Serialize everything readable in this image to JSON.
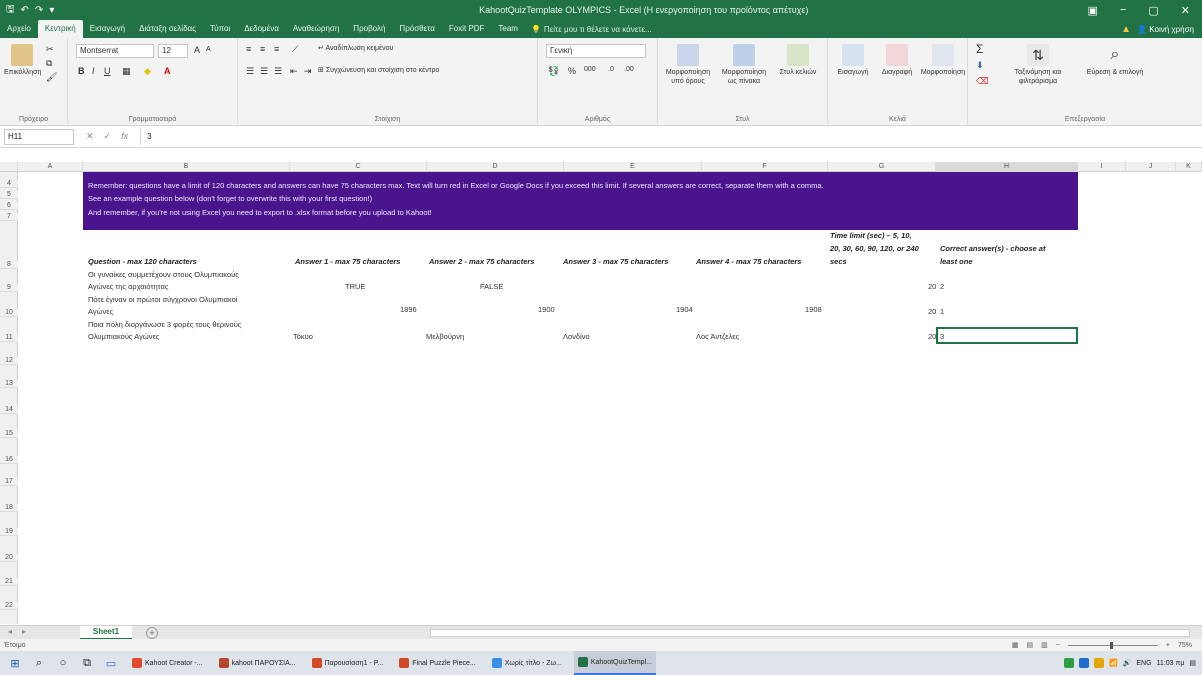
{
  "window": {
    "title": "KahootQuizTemplate OLYMPICS - Excel (Η ενεργοποίηση του προϊόντος απέτυχε)",
    "user": "Κοινή χρήση",
    "min": "−",
    "max": "▢",
    "close": "✕"
  },
  "tabs": [
    "Αρχείο",
    "Κεντρική",
    "Εισαγωγή",
    "Διάταξη σελίδας",
    "Τύποι",
    "Δεδομένα",
    "Αναθεώρηση",
    "Προβολή",
    "Πρόσθετα",
    "Foxit PDF",
    "Team"
  ],
  "tell_me": "Πείτε μου τι θέλετε να κάνετε...",
  "ribbon": {
    "paste": "Επικόλληση",
    "clipboard": "Πρόχειρο",
    "font_name": "Montserrat",
    "font_size": "12",
    "font_group": "Γραμματοσειρά",
    "wrap_text": "Αναδίπλωση κειμένου",
    "merge_center": "Συγχώνευση και στοίχιση στο κέντρο",
    "alignment_group": "Στοίχιση",
    "number_format": "Γενική",
    "number_group": "Αριθμός",
    "cond_format": "Μορφοποίηση υπό όρους",
    "format_table": "Μορφοποίηση ως πίνακα",
    "cell_styles": "Στυλ κελιών",
    "styles_group": "Στυλ",
    "insert": "Εισαγωγή",
    "delete": "Διαγραφή",
    "format": "Μορφοποίηση",
    "cells_group": "Κελιά",
    "sort_filter": "Ταξινόμηση και φιλτράρισμα",
    "find_select": "Εύρεση & επιλογή",
    "editing_group": "Επεξεργασία"
  },
  "formula_bar": {
    "name_box": "H11",
    "value": "3"
  },
  "columns": [
    "A",
    "B",
    "C",
    "D",
    "E",
    "F",
    "G",
    "H",
    "I",
    "J",
    "K"
  ],
  "rows": [
    "4",
    "5",
    "6",
    "7",
    "8",
    "9",
    "10",
    "11",
    "12",
    "13",
    "14",
    "15",
    "16",
    "17",
    "18",
    "19",
    "20",
    "21",
    "22"
  ],
  "notes": [
    "Remember: questions have a limit of 120 characters and answers can have 75 characters max. Text will turn red in Excel or Google Docs if you exceed this limit. If several answers are correct, separate them with a comma.",
    "See an example question below (don't forget to overwrite this with your first question!)",
    "And remember,  if you're not using Excel you need to export to .xlsx format before you upload to Kahoot!"
  ],
  "headers": {
    "question": "Question - max 120 characters",
    "a1": "Answer 1 - max 75 characters",
    "a2": "Answer 2 - max 75 characters",
    "a3": "Answer 3 - max 75 characters",
    "a4": "Answer 4 - max 75 characters",
    "time_l1": "Time limit (sec) – 5, 10,",
    "time_l2": "20, 30, 60, 90, 120, or 240",
    "time_l3": "secs",
    "correct_l1": "Correct answer(s) - choose at",
    "correct_l2": "least one"
  },
  "questions": [
    {
      "n": "1",
      "q1": "Οι γυναίκες συμμετέχουν στους Ολυμπιακούς",
      "q2": "Αγώνες της αρχαιότητας",
      "a1": "TRUE",
      "a2": "FALSE",
      "a3": "",
      "a4": "",
      "time": "20",
      "correct": "2"
    },
    {
      "n": "2",
      "q1": "Πότε έγιναν οι πρώτοι σύγχρονοι Ολυμπιακοί",
      "q2": "Αγώνες",
      "a1": "1896",
      "a2": "1900",
      "a3": "1904",
      "a4": "1908",
      "time": "20",
      "correct": "1"
    },
    {
      "n": "3",
      "q1": "Ποια πόλη διοργάνωσε 3 φορές τους θερινούς",
      "q2": "Ολυμπιακούς Αγώνες",
      "a1": "Τόκυο",
      "a2": "Μελβούρνη",
      "a3": "Λονδίνο",
      "a4": "Λος Άντζελες",
      "time": "20",
      "correct": "3"
    }
  ],
  "empty_numbers": [
    "4",
    "5",
    "6",
    "7",
    "8",
    "9",
    "10",
    "11",
    "12",
    "13",
    "14"
  ],
  "sheet_tab": "Sheet1",
  "add_sheet": "+",
  "status": "Έτοιμο",
  "zoom": "75%",
  "taskbar": {
    "apps": [
      "Kahoot Creator -...",
      "kahoot ΠΑΡΟΥΣΙΑ...",
      "Παρουσίαση1 - P...",
      "Final Puzzle Piece...",
      "Χωρίς τίτλο - Ζω...",
      "KahootQuizTempl..."
    ],
    "lang": "ENG",
    "time": "11:03 πμ"
  },
  "colors": {
    "excel_green": "#217346",
    "kahoot_purple": "#4a148c"
  }
}
